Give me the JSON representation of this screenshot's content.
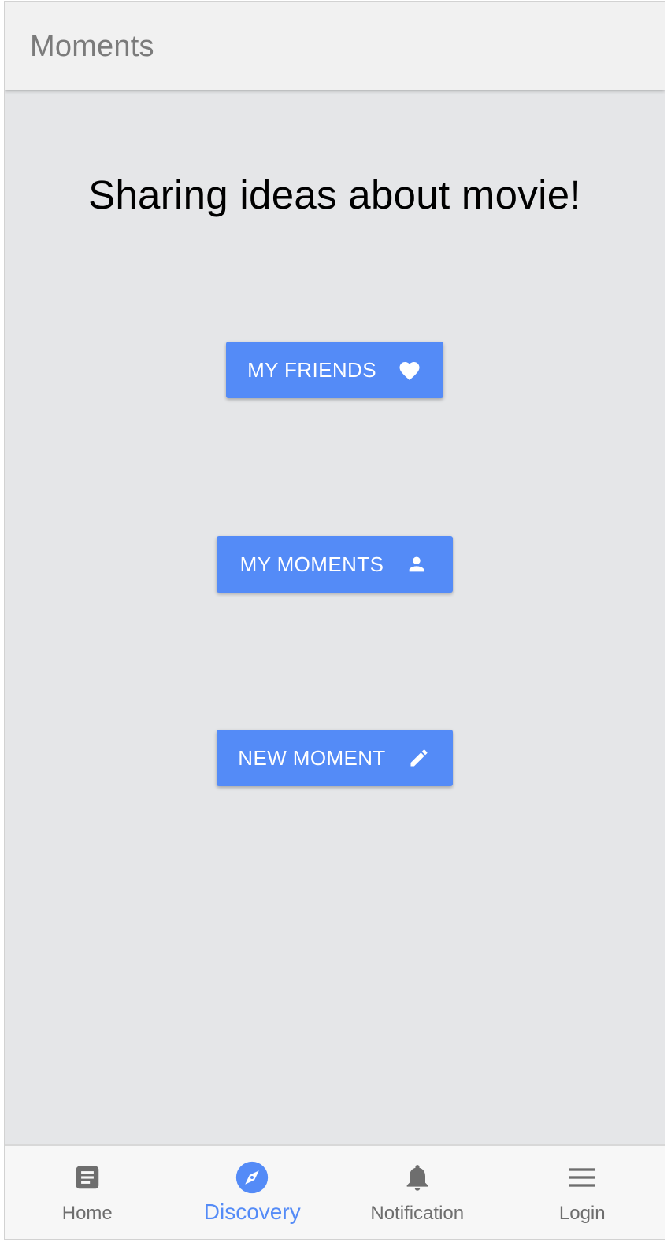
{
  "app_bar": {
    "title": "Moments"
  },
  "main": {
    "headline": "Sharing ideas about movie!",
    "buttons": [
      {
        "label": "MY FRIENDS",
        "icon": "heart-icon"
      },
      {
        "label": "MY MOMENTS",
        "icon": "person-icon"
      },
      {
        "label": "NEW MOMENT",
        "icon": "pencil-icon"
      }
    ]
  },
  "bottom_nav": {
    "active": "Discovery",
    "items": [
      {
        "label": "Home",
        "icon": "article-icon"
      },
      {
        "label": "Discovery",
        "icon": "compass-icon"
      },
      {
        "label": "Notification",
        "icon": "bell-icon"
      },
      {
        "label": "Login",
        "icon": "menu-icon"
      }
    ]
  },
  "colors": {
    "primary": "#548bf7",
    "background": "#e5e6e8",
    "app_bar": "#f1f1f1",
    "inactive_icon": "#6e6e6e"
  }
}
